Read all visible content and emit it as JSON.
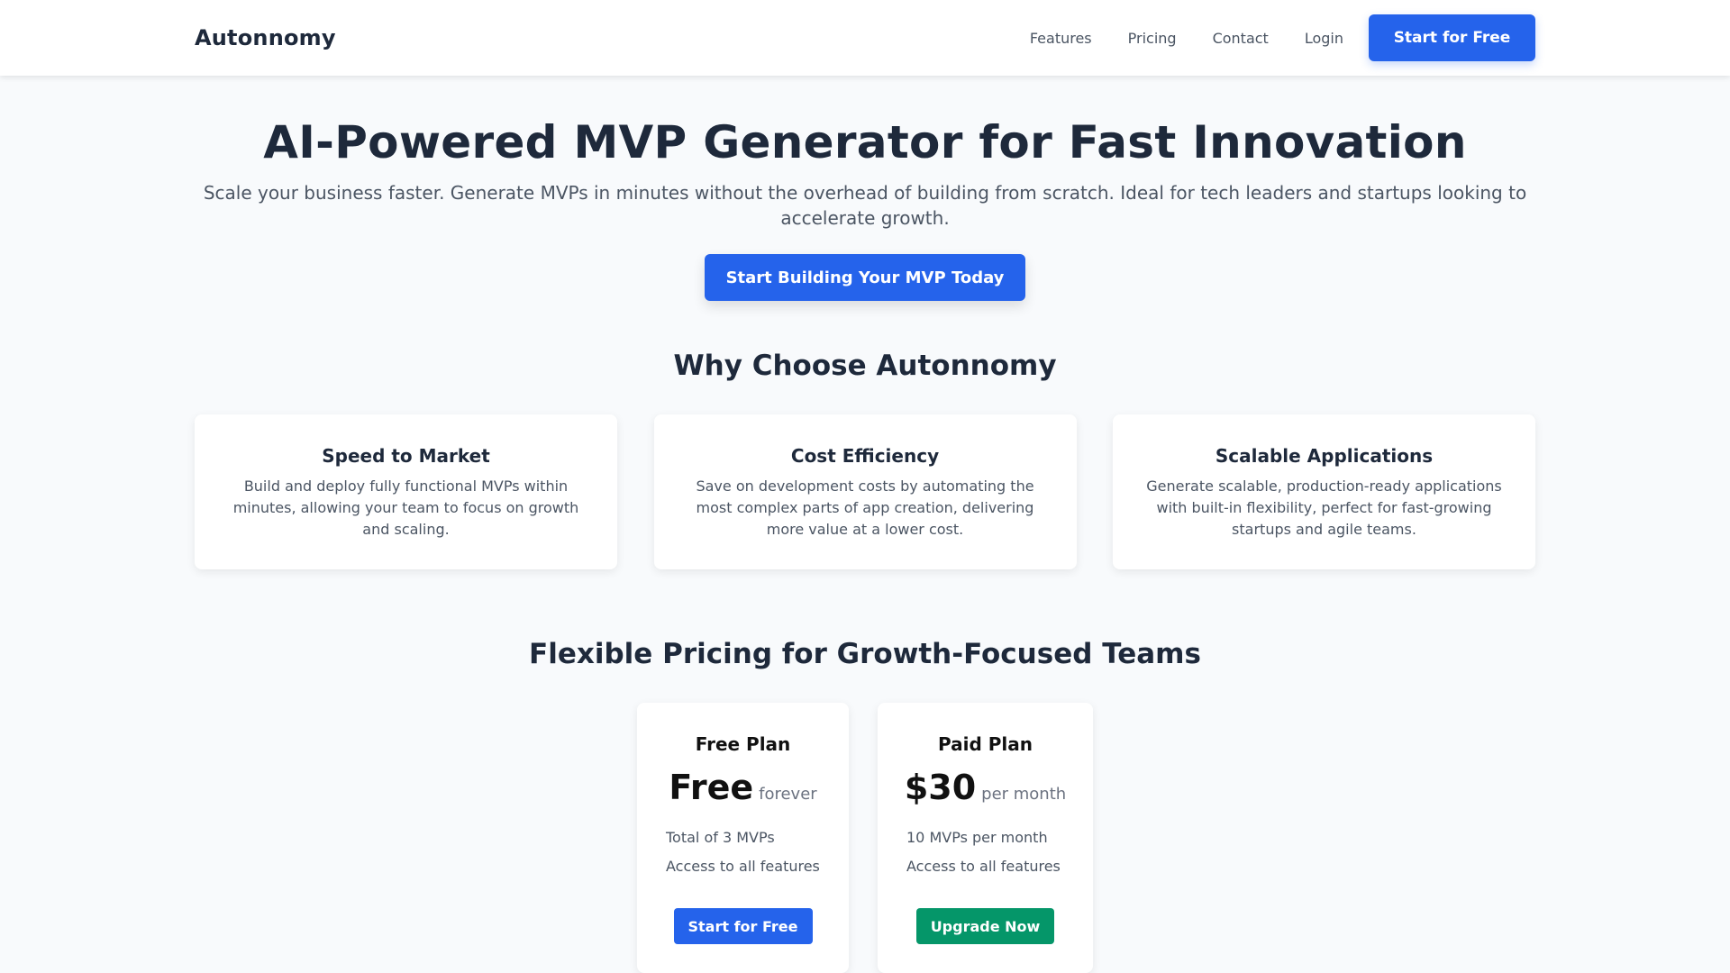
{
  "navbar": {
    "brand": "Autonnomy",
    "links": [
      {
        "label": "Features"
      },
      {
        "label": "Pricing"
      },
      {
        "label": "Contact"
      },
      {
        "label": "Login"
      }
    ],
    "cta_label": "Start for Free"
  },
  "hero": {
    "title": "AI-Powered MVP Generator for Fast Innovation",
    "subtitle": "Scale your business faster. Generate MVPs in minutes without the overhead of building from scratch. Ideal for tech leaders and startups looking to accelerate growth.",
    "cta_label": "Start Building Your MVP Today"
  },
  "why": {
    "title": "Why Choose Autonnomy",
    "cards": [
      {
        "title": "Speed to Market",
        "description": "Build and deploy fully functional MVPs within minutes, allowing your team to focus on growth and scaling."
      },
      {
        "title": "Cost Efficiency",
        "description": "Save on development costs by automating the most complex parts of app creation, delivering more value at a lower cost."
      },
      {
        "title": "Scalable Applications",
        "description": "Generate scalable, production-ready applications with built-in flexibility, perfect for fast-growing startups and agile teams."
      }
    ]
  },
  "pricing": {
    "title": "Flexible Pricing for Growth-Focused Teams",
    "plans": [
      {
        "name": "Free Plan",
        "price": "Free",
        "period": "forever",
        "features": [
          "Total of 3 MVPs",
          "Access to all features"
        ],
        "button_label": "Start for Free",
        "button_color": "#2563eb"
      },
      {
        "name": "Paid Plan",
        "price": "$30",
        "period": "per month",
        "features": [
          "10 MVPs per month",
          "Access to all features"
        ],
        "button_label": "Upgrade Now",
        "button_color": "#059669"
      }
    ]
  },
  "colors": {
    "primary": "#2563eb",
    "success": "#059669",
    "background": "#f8fafc",
    "heading": "#1e293b",
    "body_text": "#4b5563"
  }
}
